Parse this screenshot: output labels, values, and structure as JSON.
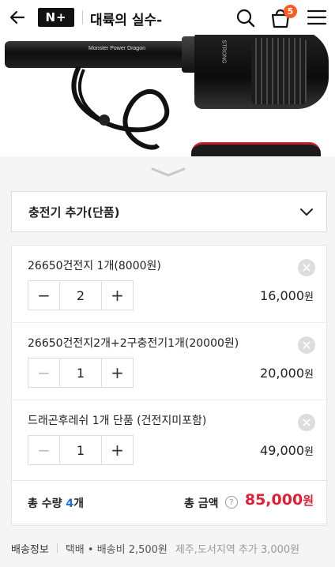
{
  "header": {
    "logo_text": "N+",
    "store_name": "대륙의 실수-",
    "cart_count": "5"
  },
  "photo": {
    "torch1_text": "Monster Power Dragon",
    "torch2_text": "STRONG"
  },
  "option_select": {
    "label": "충전기 추가(단품)"
  },
  "items": [
    {
      "name": "26650건전지 1개(8000원)",
      "qty": "2",
      "price": "16,000",
      "unit": "원",
      "minus_disabled": false
    },
    {
      "name": "26650건전지2개+2구충전기1개(20000원)",
      "qty": "1",
      "price": "20,000",
      "unit": "원",
      "minus_disabled": true
    },
    {
      "name": "드래곤후레쉬 1개 단품 (건전지미포함)",
      "qty": "1",
      "price": "49,000",
      "unit": "원",
      "minus_disabled": true
    }
  ],
  "stepper": {
    "minus": "−",
    "plus": "+"
  },
  "total": {
    "qty_prefix": "총 수량 ",
    "qty_value": "4",
    "qty_suffix": "개",
    "amount_label": "총 금액",
    "help": "?",
    "amount": "85,000",
    "amount_unit": "원"
  },
  "shipping": {
    "label": "배송정보",
    "method": "택배 • 배송비 2,500원",
    "extra": "제주,도서지역 추가 3,000원"
  },
  "colors": {
    "accent_red": "#e31e34",
    "badge_orange": "#ff5a1f",
    "qty_blue": "#1e6fd9"
  }
}
